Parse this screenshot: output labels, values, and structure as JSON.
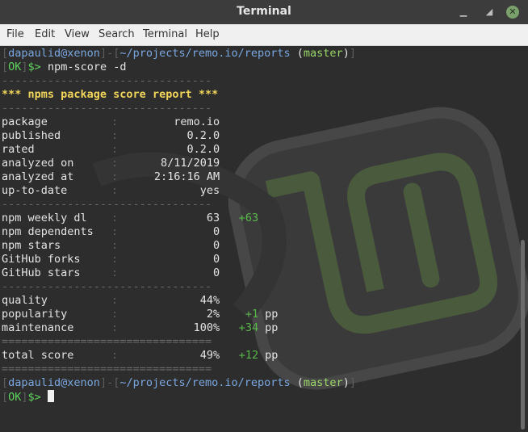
{
  "window": {
    "title": "Terminal"
  },
  "menu": [
    "File",
    "Edit",
    "View",
    "Search",
    "Terminal",
    "Help"
  ],
  "colors": {
    "prompt_user": "#7aa7e0",
    "ok": "#5fd35f",
    "branch": "#9bd968",
    "header": "#f0d55a",
    "delta": "#59b84a"
  },
  "prompt": {
    "user_host": "dapaulid@xenon",
    "path": "~/projects/remo.io/reports",
    "branch": "master",
    "ok": "OK",
    "symbol": "$>"
  },
  "command": "npm-score -d",
  "report": {
    "separator": "--------------------------------",
    "heading": "*** npms package score report ***",
    "info": [
      {
        "label": "package",
        "value": "remo.io"
      },
      {
        "label": "published",
        "value": "0.2.0"
      },
      {
        "label": "rated",
        "value": "0.2.0"
      },
      {
        "label": "analyzed on",
        "value": "8/11/2019"
      },
      {
        "label": "analyzed at",
        "value": "2:16:16 AM"
      },
      {
        "label": "up-to-date",
        "value": "yes"
      }
    ],
    "stats": [
      {
        "label": "npm weekly dl",
        "value": "63",
        "delta": "+63"
      },
      {
        "label": "npm dependents",
        "value": "0",
        "delta": ""
      },
      {
        "label": "npm stars",
        "value": "0",
        "delta": ""
      },
      {
        "label": "GitHub forks",
        "value": "0",
        "delta": ""
      },
      {
        "label": "GitHub stars",
        "value": "0",
        "delta": ""
      }
    ],
    "scores": [
      {
        "label": "quality",
        "value": "44%",
        "delta": "",
        "unit": ""
      },
      {
        "label": "popularity",
        "value": "2%",
        "delta": "+1",
        "unit": "pp"
      },
      {
        "label": "maintenance",
        "value": "100%",
        "delta": "+34",
        "unit": "pp"
      }
    ],
    "double_separator": "================================",
    "total": {
      "label": "total score",
      "value": "49%",
      "delta": "+12",
      "unit": "pp"
    }
  }
}
